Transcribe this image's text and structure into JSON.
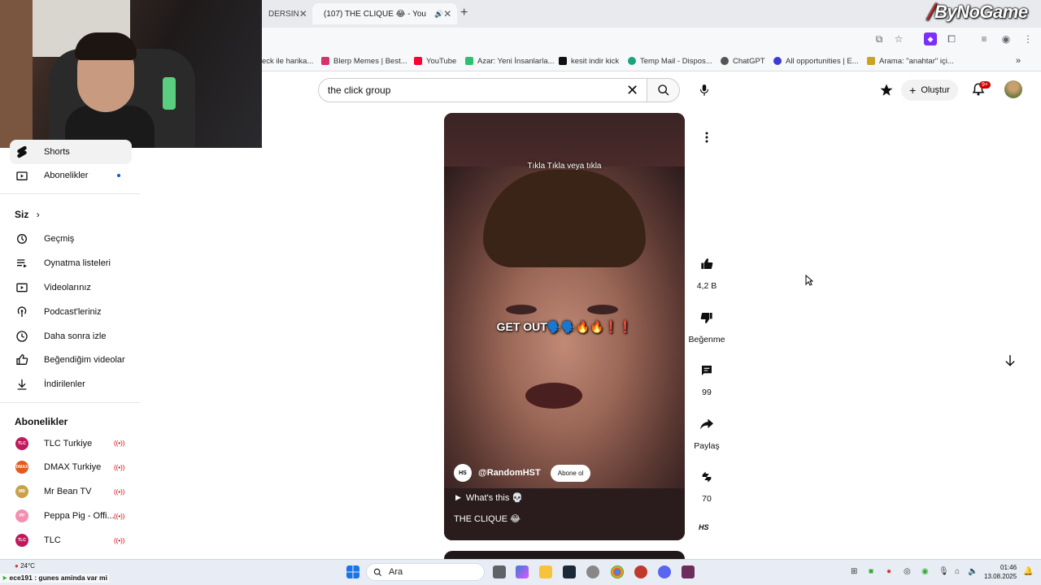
{
  "browser": {
    "tabs": [
      {
        "label": "DERSIN"
      },
      {
        "label": "(107) THE CLIQUE 😂 - You"
      }
    ],
    "brand": "ByNoGame",
    "bookmarks": [
      {
        "label": "eck ile harika...",
        "color": "#444444"
      },
      {
        "label": "Blerp Memes | Best...",
        "color": "#d6336c"
      },
      {
        "label": "YouTube",
        "color": "#ff0033"
      },
      {
        "label": "Azar: Yeni İnsanlarla...",
        "color": "#2fbf71"
      },
      {
        "label": "kesit indir kick",
        "color": "#111111"
      },
      {
        "label": "Temp Mail - Dispos...",
        "color": "#1aa37a"
      },
      {
        "label": "ChatGPT",
        "color": "#555555"
      },
      {
        "label": "All opportunities | E...",
        "color": "#3b3bd6"
      },
      {
        "label": "Arama: \"anahtar\" içi...",
        "color": "#c9a227"
      }
    ]
  },
  "header": {
    "search_value": "the click group",
    "create_label": "Oluştur",
    "notif_count": "9+"
  },
  "sidebar": {
    "top_items": [
      {
        "label": "Shorts",
        "icon": "shorts-icon"
      },
      {
        "label": "Abonelikler",
        "icon": "subscriptions-icon"
      }
    ],
    "you_heading": "Siz",
    "you_items": [
      {
        "label": "Geçmiş",
        "icon": "history-icon"
      },
      {
        "label": "Oynatma listeleri",
        "icon": "playlists-icon"
      },
      {
        "label": "Videolarınız",
        "icon": "your-videos-icon"
      },
      {
        "label": "Podcast'leriniz",
        "icon": "podcasts-icon"
      },
      {
        "label": "Daha sonra izle",
        "icon": "watch-later-icon"
      },
      {
        "label": "Beğendiğim videolar",
        "icon": "liked-videos-icon"
      },
      {
        "label": "İndirilenler",
        "icon": "downloads-icon"
      }
    ],
    "subs_heading": "Abonelikler",
    "subscriptions": [
      {
        "label": "TLC Turkiye",
        "avatar": "TLC",
        "color": "#c2185b"
      },
      {
        "label": "DMAX Turkiye",
        "avatar": "DMAX",
        "color": "#e55a1f"
      },
      {
        "label": "Mr Bean TV",
        "avatar": "MB",
        "color": "#c8a24a"
      },
      {
        "label": "Peppa Pig - Offi...",
        "avatar": "PP",
        "color": "#f48fb1"
      },
      {
        "label": "TLC",
        "avatar": "TLC",
        "color": "#c2185b"
      }
    ]
  },
  "short": {
    "caption": "Tıkla Tıkla veya tıkla",
    "overlay_text": "GET OUT🗣️🗣️🔥🔥❗❗",
    "channel_logo": "HS",
    "channel": "@RandomHST",
    "subscribe_label": "Abone ol",
    "whats_this": "What's this 💀",
    "title": "THE CLIQUE 😂"
  },
  "actions": {
    "like_count": "4,2 B",
    "dislike_label": "Beğenme",
    "comment_count": "99",
    "share_label": "Paylaş",
    "remix_count": "70",
    "channel_badge": "HS"
  },
  "taskbar": {
    "search_label": "Ara",
    "weather": "24°C",
    "ticker": "ece191 : gunes aminda var mi",
    "time": "01:46",
    "date": "13.08.2025"
  }
}
